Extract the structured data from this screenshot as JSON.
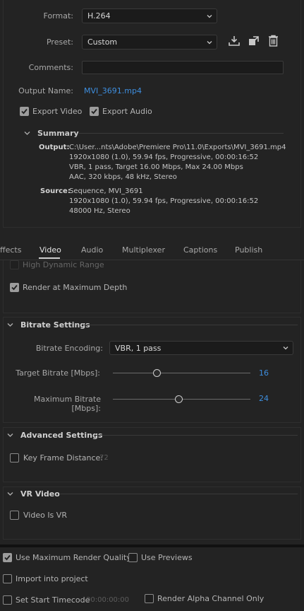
{
  "export": {
    "format_label": "Format:",
    "format_value": "H.264",
    "preset_label": "Preset:",
    "preset_value": "Custom",
    "comments_label": "Comments:",
    "comments_value": "",
    "output_name_label": "Output Name:",
    "output_name_value": "MVI_3691.mp4",
    "export_video_label": "Export Video",
    "export_video_checked": true,
    "export_audio_label": "Export Audio",
    "export_audio_checked": true
  },
  "summary": {
    "title": "Summary",
    "output_label": "Output:",
    "output_lines": [
      "C:\\User...nts\\Adobe\\Premiere Pro\\11.0\\Exports\\MVI_3691.mp4",
      "1920x1080 (1.0), 59.94 fps, Progressive, 00:00:16:52",
      "VBR, 1 pass, Target 16.00 Mbps, Max 24.00 Mbps",
      "AAC, 320 kbps, 48 kHz, Stereo"
    ],
    "source_label": "Source:",
    "source_lines": [
      "Sequence, MVI_3691",
      "1920x1080 (1.0), 59.94 fps, Progressive, 00:00:16:52",
      "48000 Hz, Stereo"
    ]
  },
  "tabs": [
    "ffects",
    "Video",
    "Audio",
    "Multiplexer",
    "Captions",
    "Publish"
  ],
  "active_tab": "Video",
  "video": {
    "hdr_label": "High Dynamic Range",
    "render_max_depth_label": "Render at Maximum Depth",
    "render_max_depth_checked": true
  },
  "bitrate": {
    "title": "Bitrate Settings",
    "encoding_label": "Bitrate Encoding:",
    "encoding_value": "VBR, 1 pass",
    "target_label": "Target Bitrate [Mbps]:",
    "target_value": "16",
    "target_fraction": 0.32,
    "max_label": "Maximum Bitrate [Mbps]:",
    "max_value": "24",
    "max_fraction": 0.48
  },
  "advanced": {
    "title": "Advanced Settings",
    "key_frame_label": "Key Frame Distance:",
    "key_frame_value": "72"
  },
  "vr": {
    "title": "VR Video",
    "video_is_vr_label": "Video Is VR"
  },
  "bottom": {
    "use_max_quality_label": "Use Maximum Render Quality",
    "use_max_quality_checked": true,
    "use_previews_label": "Use Previews",
    "import_label": "Import into project",
    "start_tc_label": "Set Start Timecode",
    "start_tc_value": "00:00:00:00",
    "alpha_label": "Render Alpha Channel Only"
  },
  "colors": {
    "accent": "#3e8ede",
    "background": "#232323"
  }
}
